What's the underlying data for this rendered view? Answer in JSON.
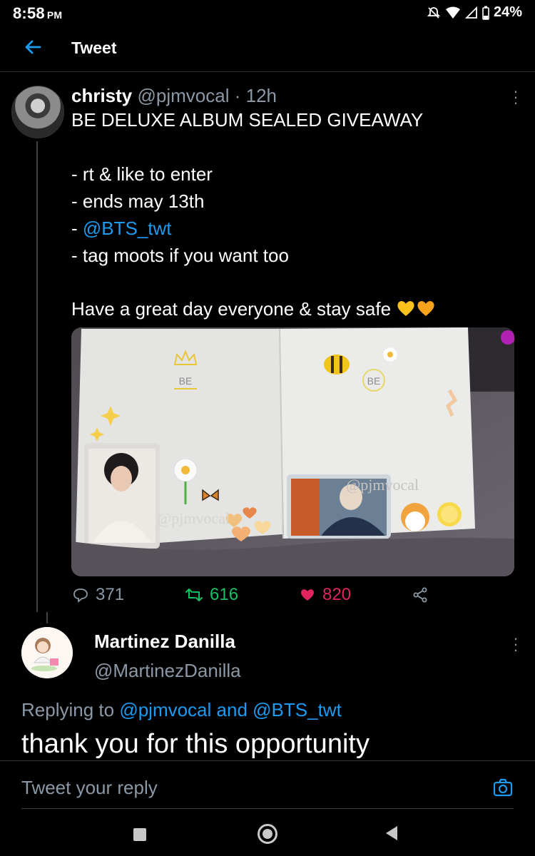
{
  "status_bar": {
    "time": "8:58",
    "ampm": "PM",
    "battery": "24%"
  },
  "header": {
    "title": "Tweet"
  },
  "tweet": {
    "author_name": "christy",
    "handle": "@pjmvocal",
    "separator": "·",
    "time": "12h",
    "lines": [
      "BE DELUXE ALBUM SEALED GIVEAWAY",
      "- rt & like to enter",
      "- ends may 13th",
      "- ",
      "- tag moots if you want too",
      "Have a great day everyone & stay safe"
    ],
    "mention": "@BTS_twt",
    "photo_texts": {
      "be_left": "BE",
      "be_right": "BE",
      "watermark_left": "@pjmvocal",
      "watermark_right": "@pjmvocal"
    },
    "replies": "371",
    "retweets": "616",
    "likes": "820"
  },
  "reply": {
    "name": "Martinez Danilla",
    "handle": "@MartinezDanilla",
    "replying_prefix": "Replying to",
    "replying_user1": "@pjmvocal",
    "replying_and": "and",
    "replying_user2": "@BTS_twt",
    "text": "thank you for this opportunity"
  },
  "composer": {
    "placeholder": "Tweet your reply"
  },
  "colors": {
    "accent": "#1d9bf0",
    "retweet": "#17bf63",
    "like": "#e0245e",
    "muted": "#8b98a5"
  }
}
